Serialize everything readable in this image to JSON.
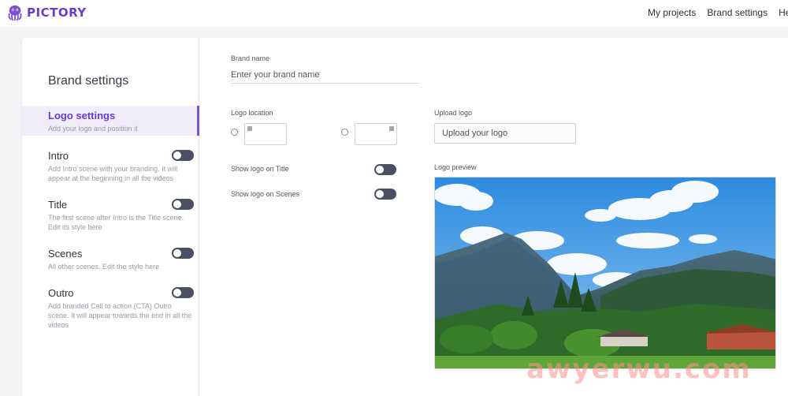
{
  "header": {
    "brand": "PICTORY",
    "nav": [
      {
        "label": "My projects"
      },
      {
        "label": "Brand settings"
      },
      {
        "label": "Help"
      }
    ]
  },
  "sidebar": {
    "title": "Brand settings",
    "items": [
      {
        "label": "Logo settings",
        "desc": "Add your logo and position it",
        "active": true
      },
      {
        "label": "Intro",
        "desc": "Add Intro scene with your branding. It will appear at the beginning in all the videos"
      },
      {
        "label": "Title",
        "desc": "The first scene after Intro is the Title scene. Edit its style here"
      },
      {
        "label": "Scenes",
        "desc": "All other scenes. Edit the style here"
      },
      {
        "label": "Outro",
        "desc": "Add branded Call to action (CTA) Outro scene. It will appear towards the end in all the videos"
      }
    ]
  },
  "form": {
    "brand_name_label": "Brand name",
    "brand_name_placeholder": "Enter your brand name",
    "logo_location_label": "Logo location",
    "upload_logo_label": "Upload logo",
    "upload_logo_placeholder": "Upload your logo",
    "show_on_title_label": "Show logo on Title",
    "show_on_scenes_label": "Show logo on Scenes",
    "logo_preview_label": "Logo preview"
  },
  "colors": {
    "brand_purple": "#6b3bd1",
    "toggle_off": "#4a4f63",
    "active_bg": "#f0ecf9"
  },
  "watermark": "awyerwu.com"
}
